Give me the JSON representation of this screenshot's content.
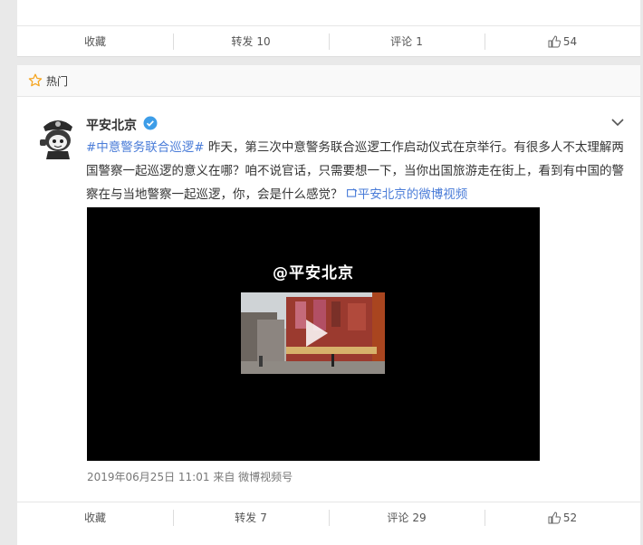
{
  "top_card": {
    "actions": {
      "collect": "收藏",
      "repost": "转发",
      "repost_count": "10",
      "comment": "评论",
      "comment_count": "1",
      "like_count": "54"
    }
  },
  "hot_label": "热门",
  "post": {
    "author": "平安北京",
    "hashtag": "#中意警务联合巡逻#",
    "body": " 昨天，第三次中意警务联合巡逻工作启动仪式在京举行。有很多人不太理解两国警察一起巡逻的意义在哪？咱不说官话，只需要想一下，当你出国旅游走在街上，看到有中国的警察在与当地警察一起巡逻，你，会是什么感觉？ ",
    "video_link": "平安北京的微博视频",
    "video_watermark": "@平安北京",
    "date": "2019年06月25日 11:01",
    "source_prefix": "来自",
    "source": "微博视频号"
  },
  "actions": {
    "collect": "收藏",
    "repost": "转发",
    "repost_count": "7",
    "comment": "评论",
    "comment_count": "29",
    "like_count": "52"
  },
  "colors": {
    "link": "#4a7cd8",
    "verify": "#3d9de8",
    "star": "#f5a623"
  }
}
